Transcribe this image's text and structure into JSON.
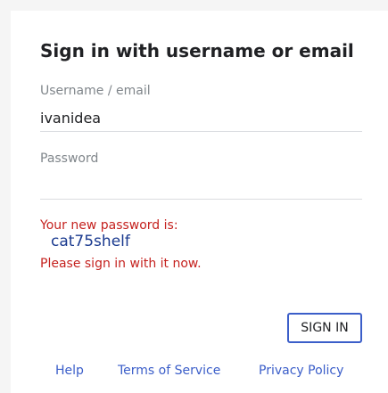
{
  "form": {
    "title": "Sign in with username or email",
    "username_label": "Username / email",
    "username_value": "ivanidea",
    "password_label": "Password",
    "password_value": ""
  },
  "message": {
    "line1": "Your new password is:",
    "new_password": "cat75shelf",
    "line3": "Please sign in with it now."
  },
  "actions": {
    "signin_label": "SIGN IN"
  },
  "footer": {
    "help": "Help",
    "terms": "Terms of Service",
    "privacy": "Privacy Policy"
  },
  "colors": {
    "accent": "#3b5ec9",
    "error": "#c5221f",
    "password_text": "#1a3a8f"
  }
}
